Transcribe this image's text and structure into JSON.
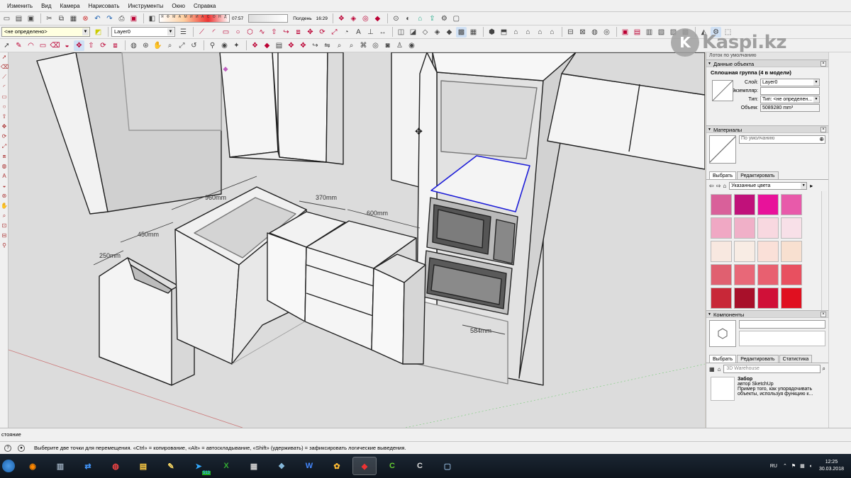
{
  "menu": [
    "Изменить",
    "Вид",
    "Камера",
    "Нарисовать",
    "Инструменты",
    "Окно",
    "Справка"
  ],
  "toolbar": {
    "layer_combo": "<не определено>",
    "layer_name": "Layer0",
    "shadow_months": "Я Ф М А М И И А С О Н Д",
    "time_start": "07:57",
    "time_mid": "Полдень",
    "time_end": "16:29"
  },
  "viewport": {
    "dimensions": [
      "960mm",
      "450mm",
      "250mm",
      "370mm",
      "600mm",
      "584mm"
    ]
  },
  "tray": {
    "title": "Лоток по умолчанию",
    "entity_info": {
      "header": "Данные объекта",
      "title": "Сплошная группа (4 в модели)",
      "layer_label": "Слой:",
      "layer_value": "Layer0",
      "instance_label": "Экземпляр:",
      "instance_value": "",
      "type_label": "Тип:",
      "type_value": "Тип: <не определен...",
      "volume_label": "Объем:",
      "volume_value": "5089280 mm³"
    },
    "materials": {
      "header": "Материалы",
      "default_name": "По умолчанию",
      "tab_select": "Выбрать",
      "tab_edit": "Редактировать",
      "collection": "Указанные цвета",
      "swatch_colors": [
        "#d9609a",
        "#c0117a",
        "#e8129a",
        "#e85aaa",
        "#f0a8c4",
        "#f0b0c8",
        "#f8d8e0",
        "#f8e0e8",
        "#f8e8e0",
        "#f8ece4",
        "#fae0d8",
        "#f8e0d0",
        "#e06070",
        "#e86878",
        "#e86070",
        "#e85060",
        "#c82838",
        "#a8102a",
        "#d01038",
        "#e01020"
      ]
    },
    "components": {
      "header": "Компоненты",
      "tab_select": "Выбрать",
      "tab_edit": "Редактировать",
      "tab_stats": "Статистика",
      "search_placeholder": "3D Warehouse",
      "item_title": "Забор",
      "item_author": "автор SketchUp",
      "item_desc1": "Пример того, как упорядочивать",
      "item_desc2": "объекты, используя функцию к..."
    }
  },
  "status": {
    "line1": "стояние",
    "line2": "Выберите две точки для перемещения.  «Ctrl» = копирование, «Alt» = автоскладывание, «Shift» (удерживать) = зафиксировать логические выведения."
  },
  "taskbar": {
    "apps": [
      "firefox",
      "files",
      "teamviewer",
      "chrome",
      "explorer",
      "notes",
      "telegram",
      "excel",
      "calc",
      "word",
      "paint",
      "sketchup",
      "camtasia",
      "camtasia2",
      "window"
    ],
    "badge": "513",
    "lang": "RU",
    "time": "12:25",
    "date": "30.03.2018"
  },
  "watermark": "Kaspi.kz"
}
